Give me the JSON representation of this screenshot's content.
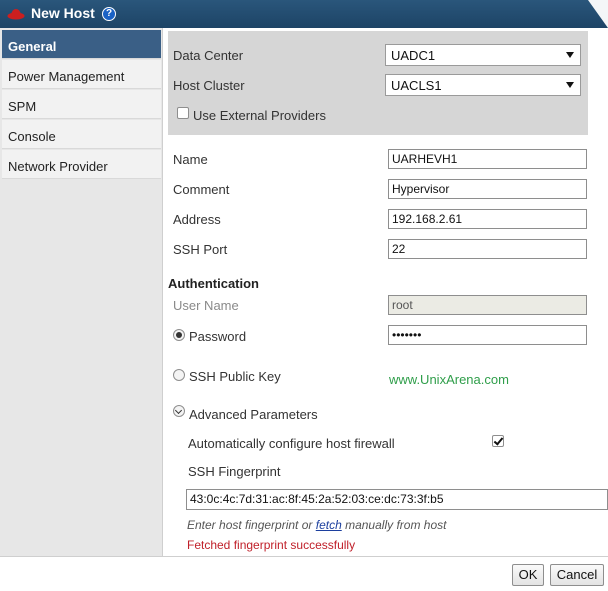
{
  "window": {
    "title": "New Host",
    "help": "?"
  },
  "sidebar": {
    "items": [
      {
        "label": "General"
      },
      {
        "label": "Power Management"
      },
      {
        "label": "SPM"
      },
      {
        "label": "Console"
      },
      {
        "label": "Network Provider"
      }
    ]
  },
  "general": {
    "data_center_label": "Data Center",
    "data_center_value": "UADC1",
    "host_cluster_label": "Host Cluster",
    "host_cluster_value": "UACLS1",
    "use_external_providers_label": "Use External Providers",
    "name_label": "Name",
    "name_value": "UARHEVH1",
    "comment_label": "Comment",
    "comment_value": "Hypervisor",
    "address_label": "Address",
    "address_value": "192.168.2.61",
    "ssh_port_label": "SSH Port",
    "ssh_port_value": "22"
  },
  "authentication": {
    "title": "Authentication",
    "user_name_label": "User Name",
    "user_name_value": "root",
    "password_label": "Password",
    "password_value": "•••••••",
    "ssh_public_key_label": "SSH Public Key"
  },
  "watermark": "www.UnixArena.com",
  "advanced": {
    "title": "Advanced Parameters",
    "auto_firewall_label": "Automatically configure host firewall",
    "ssh_fingerprint_label": "SSH Fingerprint",
    "ssh_fingerprint_value": "43:0c:4c:7d:31:ac:8f:45:2a:52:03:ce:dc:73:3f:b5",
    "hint_prefix": "Enter host fingerprint or ",
    "hint_link": "fetch",
    "hint_suffix": " manually from host",
    "status_message": "Fetched fingerprint successfully"
  },
  "footer": {
    "ok_label": "OK",
    "cancel_label": "Cancel"
  }
}
